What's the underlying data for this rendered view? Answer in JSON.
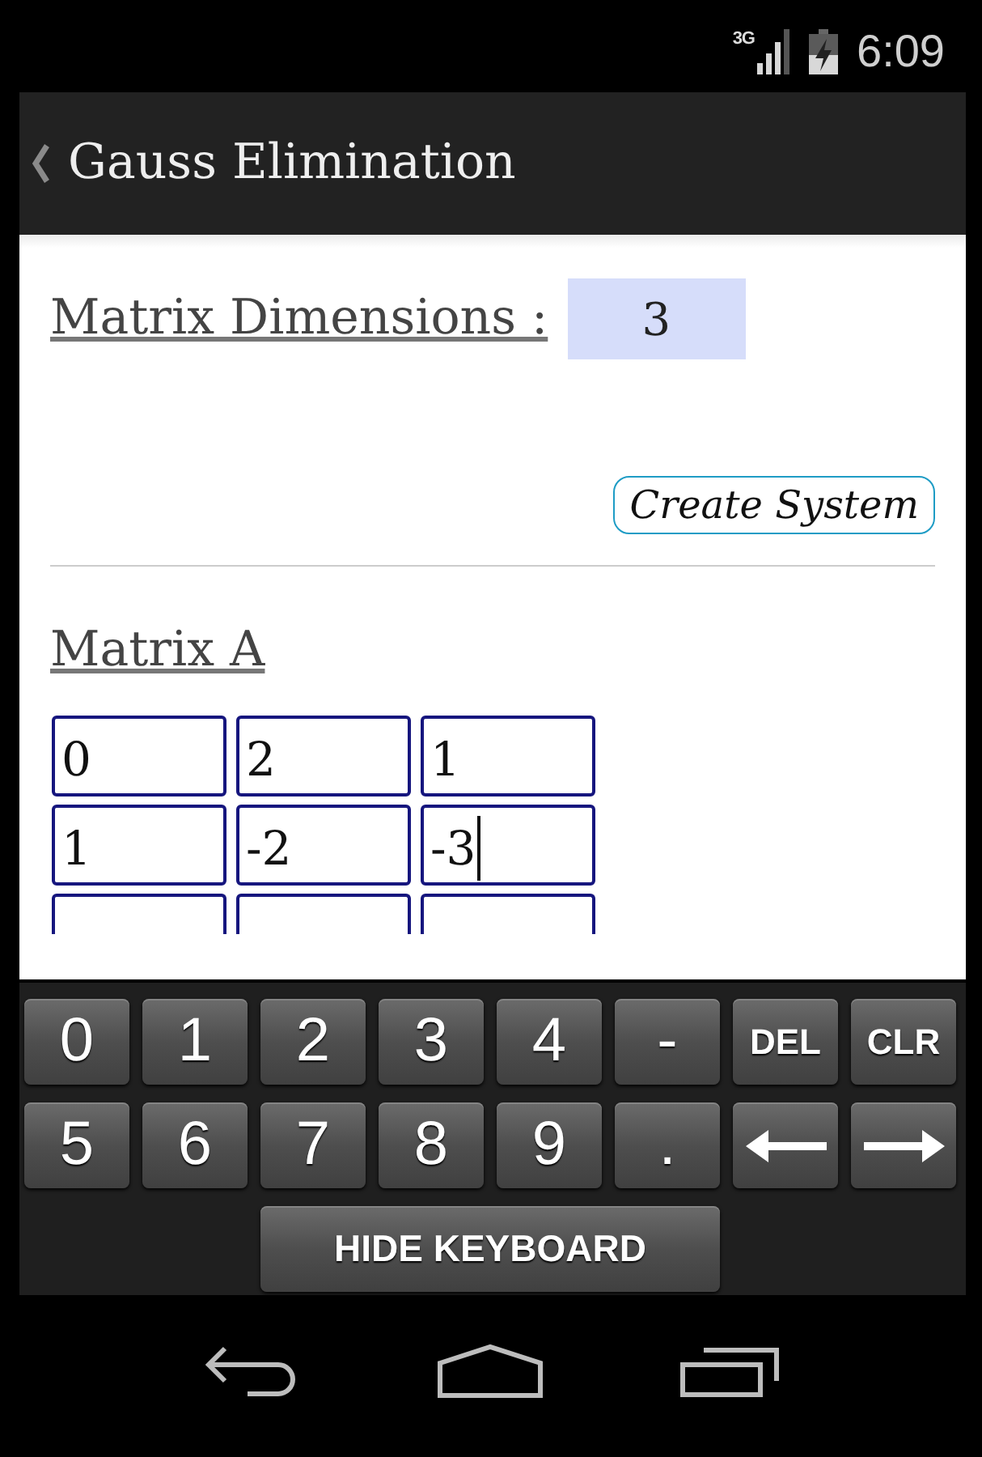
{
  "status_bar": {
    "network_type": "3G",
    "time": "6:09"
  },
  "action_bar": {
    "title": "Gauss Elimination"
  },
  "dimensions": {
    "label": "Matrix Dimensions :",
    "value": "3"
  },
  "create_button": {
    "label": "Create System"
  },
  "matrix_a": {
    "title": "Matrix A",
    "rows": [
      {
        "cut_off": false,
        "cells": [
          {
            "value": "0",
            "focused": false
          },
          {
            "value": "2",
            "focused": false
          },
          {
            "value": "1",
            "focused": false
          }
        ]
      },
      {
        "cut_off": false,
        "cells": [
          {
            "value": "1",
            "focused": false
          },
          {
            "value": "-2",
            "focused": false
          },
          {
            "value": "-3",
            "focused": true
          }
        ]
      },
      {
        "cut_off": true,
        "cells": [
          {
            "focused": false
          },
          {
            "focused": false
          },
          {
            "focused": false
          }
        ]
      }
    ]
  },
  "keyboard": {
    "rows": [
      [
        {
          "kind": "char",
          "label": "0"
        },
        {
          "kind": "char",
          "label": "1"
        },
        {
          "kind": "char",
          "label": "2"
        },
        {
          "kind": "char",
          "label": "3"
        },
        {
          "kind": "char",
          "label": "4"
        },
        {
          "kind": "char",
          "label": "-"
        },
        {
          "kind": "command",
          "label": "DEL"
        },
        {
          "kind": "command",
          "label": "CLR"
        }
      ],
      [
        {
          "kind": "char",
          "label": "5"
        },
        {
          "kind": "char",
          "label": "6"
        },
        {
          "kind": "char",
          "label": "7"
        },
        {
          "kind": "char",
          "label": "8"
        },
        {
          "kind": "char",
          "label": "9"
        },
        {
          "kind": "char",
          "label": "."
        },
        {
          "kind": "arrow_left"
        },
        {
          "kind": "arrow_right"
        }
      ]
    ],
    "hide_button": {
      "label": "HIDE KEYBOARD"
    }
  }
}
